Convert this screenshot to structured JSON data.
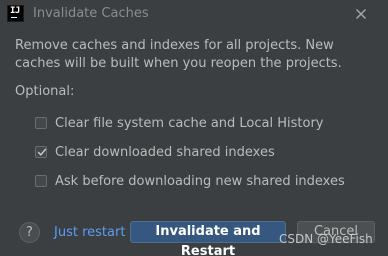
{
  "window": {
    "title": "Invalidate Caches",
    "app_icon": "intellij-idea-icon",
    "app_icon_text": "IJ",
    "close_icon": "close-icon"
  },
  "description": "Remove caches and indexes for all projects. New caches will be built when you reopen the projects.",
  "optional_label": "Optional:",
  "options": [
    {
      "label": "Clear file system cache and Local History",
      "checked": false
    },
    {
      "label": "Clear downloaded shared indexes",
      "checked": true
    },
    {
      "label": "Ask before downloading new shared indexes",
      "checked": false
    }
  ],
  "footer": {
    "help_label": "?",
    "just_restart_label": "Just restart",
    "primary_label_prefix": "Invalidate and ",
    "primary_label_mnemonic": "R",
    "primary_label_suffix": "estart",
    "cancel_label": "Cancel"
  },
  "watermark": "CSDN @YeeFish",
  "colors": {
    "background": "#3c3f41",
    "primary_button": "#365880",
    "link": "#589df6",
    "text": "#bbbbbb"
  }
}
